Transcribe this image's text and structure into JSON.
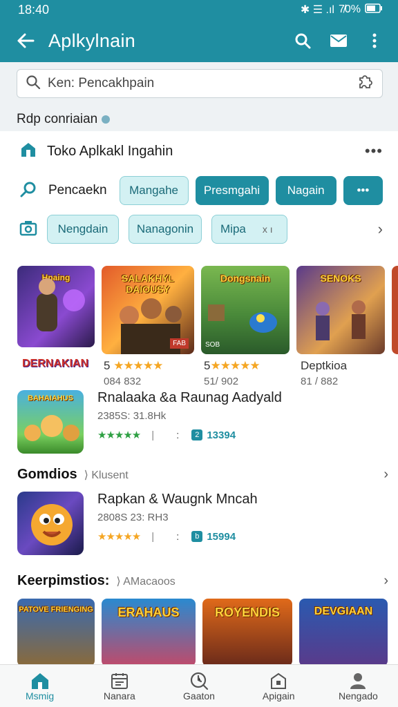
{
  "status": {
    "time": "18:40",
    "icons": "✱ ☰ .ıl",
    "battery": "7̸0%"
  },
  "appbar": {
    "title": "Aplkylnain"
  },
  "search": {
    "placeholder": "Ken: Pencakhpain",
    "subhead": "Rdp conriaian"
  },
  "store": {
    "label": "Toko Aplkakl Ingahin",
    "more": "•••"
  },
  "chips1": {
    "label": "Pencaekn",
    "items": [
      "Mangahe",
      "Presmgahi",
      "Nagain",
      "•••"
    ]
  },
  "chips2": {
    "items": [
      "Nengdain",
      "Nanagonin",
      "Mipa",
      "x ı"
    ]
  },
  "hero_titles": [
    "Hnaing",
    "SALAKHYL DAIOUSY",
    "Dongsnain",
    "SENOKS"
  ],
  "hero_badges": [
    "FAB",
    "SOB"
  ],
  "hero_logo": "DERNAKIAN",
  "hero_meta": [
    {
      "rating": "5",
      "stars": "★★★★★",
      "count": "084 832"
    },
    {
      "rating": "5",
      "stars": "★★★★★",
      "count": "51/ 902"
    },
    {
      "rating": "Deptkioa",
      "stars": "",
      "count": "81 / 882"
    }
  ],
  "item1": {
    "thumb_title": "BAHAIAHUS",
    "name": "Rnalaaka &a Raunag Aadyald",
    "size": "2385S: 31.8Hk",
    "stars": "★★★★★",
    "code": "13394",
    "badge": "2"
  },
  "section1": {
    "title": "Gomdios",
    "sub": "Klusent"
  },
  "item2": {
    "name": "Rapkan & Waugnk Mncah",
    "size": "2808S 23: RH3",
    "stars": "★★★★★",
    "code": "15994",
    "badge": "b"
  },
  "section2": {
    "title": "Keerpimstios:",
    "sub": "AMacaoos"
  },
  "bottom_titles": [
    "PATOVE FRIENGING",
    "ERAHAUS",
    "ROYENDIS",
    "DEVGIAAN"
  ],
  "nav": [
    {
      "label": "Msmig",
      "icon": "home-icon"
    },
    {
      "label": "Nanara",
      "icon": "calendar-icon"
    },
    {
      "label": "Gaaton",
      "icon": "clock-search-icon"
    },
    {
      "label": "Apigain",
      "icon": "box-icon"
    },
    {
      "label": "Nengado",
      "icon": "person-icon"
    }
  ],
  "colors": {
    "primary": "#1f8ea1",
    "chip_light": "#d3f1f3"
  }
}
